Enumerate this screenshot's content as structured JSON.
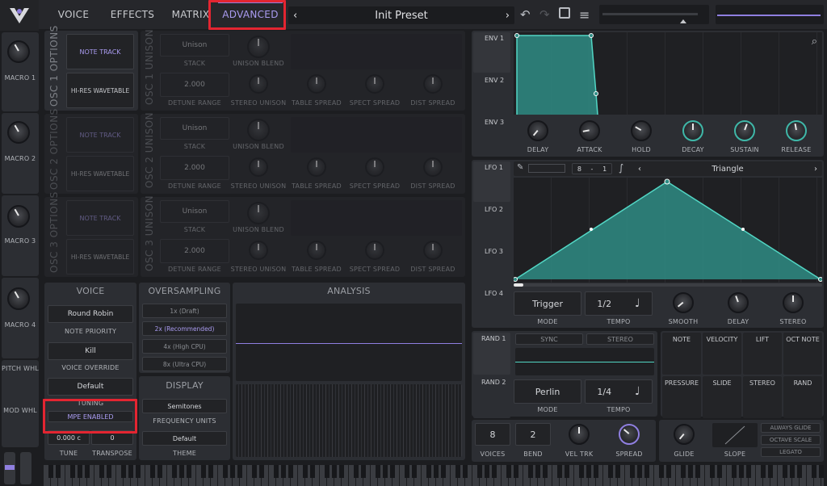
{
  "tabs": [
    {
      "label": "VOICE"
    },
    {
      "label": "EFFECTS"
    },
    {
      "label": "MATRIX"
    },
    {
      "label": "ADVANCED"
    }
  ],
  "preset": {
    "name": "Init Preset"
  },
  "macros": [
    {
      "label": "MACRO 1"
    },
    {
      "label": "MACRO 2"
    },
    {
      "label": "MACRO 3"
    },
    {
      "label": "MACRO 4"
    }
  ],
  "sidebar_bottom": {
    "pitch_label": "PITCH WHL",
    "mod_label": "MOD WHL"
  },
  "osc_options": [
    {
      "title": "OSC 1 OPTIONS",
      "unison_title": "OSC 1 UNISON",
      "note_track": "NOTE TRACK",
      "hires": "HI-RES WAVETABLE",
      "stack_value": "Unison",
      "stack_label": "STACK",
      "blend_label": "UNISON BLEND",
      "detune_value": "2.000",
      "detune_label": "DETUNE RANGE",
      "stereo_label": "STEREO UNISON",
      "table_label": "TABLE SPREAD",
      "spect_label": "SPECT SPREAD",
      "dist_label": "DIST SPREAD"
    },
    {
      "title": "OSC 2 OPTIONS",
      "unison_title": "OSC 2 UNISON",
      "note_track": "NOTE TRACK",
      "hires": "HI-RES WAVETABLE",
      "stack_value": "Unison",
      "stack_label": "STACK",
      "blend_label": "UNISON BLEND",
      "detune_value": "2.000",
      "detune_label": "DETUNE RANGE",
      "stereo_label": "STEREO UNISON",
      "table_label": "TABLE SPREAD",
      "spect_label": "SPECT SPREAD",
      "dist_label": "DIST SPREAD"
    },
    {
      "title": "OSC 3 OPTIONS",
      "unison_title": "OSC 3 UNISON",
      "note_track": "NOTE TRACK",
      "hires": "HI-RES WAVETABLE",
      "stack_value": "Unison",
      "stack_label": "STACK",
      "blend_label": "UNISON BLEND",
      "detune_value": "2.000",
      "detune_label": "DETUNE RANGE",
      "stereo_label": "STEREO UNISON",
      "table_label": "TABLE SPREAD",
      "spect_label": "SPECT SPREAD",
      "dist_label": "DIST SPREAD"
    }
  ],
  "voice": {
    "title": "VOICE",
    "priority_value": "Round Robin",
    "priority_label": "NOTE PRIORITY",
    "override_value": "Kill",
    "override_label": "VOICE OVERRIDE",
    "tuning_value": "Default",
    "tuning_label": "TUNING",
    "mpe_label": "MPE ENABLED",
    "tune_value": "0.000 c",
    "tune_label": "TUNE",
    "transpose_value": "0",
    "transpose_label": "TRANSPOSE"
  },
  "oversampling": {
    "title": "OVERSAMPLING",
    "options": [
      "1x (Draft)",
      "2x (Recommended)",
      "4x (High CPU)",
      "8x (Ultra CPU)"
    ],
    "selected_index": 1
  },
  "display": {
    "title": "DISPLAY",
    "freq_value": "Semitones",
    "freq_label": "FREQUENCY UNITS",
    "theme_value": "Default",
    "theme_label": "THEME"
  },
  "analysis": {
    "title": "ANALYSIS"
  },
  "envelopes": {
    "tabs": [
      "ENV 1",
      "ENV 2",
      "ENV 3"
    ],
    "knobs": [
      "DELAY",
      "ATTACK",
      "HOLD",
      "DECAY",
      "SUSTAIN",
      "RELEASE"
    ]
  },
  "lfos": {
    "tabs": [
      "LFO 1",
      "LFO 2",
      "LFO 3",
      "LFO 4"
    ],
    "sync_num": "8",
    "sync_den": "1",
    "shape": "Triangle",
    "mode_value": "Trigger",
    "mode_label": "MODE",
    "tempo_value": "1/2",
    "tempo_label": "TEMPO",
    "knobs": [
      "SMOOTH",
      "DELAY",
      "STEREO"
    ]
  },
  "randoms": {
    "tabs": [
      "RAND 1",
      "RAND 2"
    ],
    "sync_label": "SYNC",
    "stereo_label": "STEREO",
    "mode_value": "Perlin",
    "mode_label": "MODE",
    "tempo_value": "1/4",
    "tempo_label": "TEMPO"
  },
  "mod_sources": [
    "NOTE",
    "VELOCITY",
    "LIFT",
    "OCT NOTE",
    "PRESSURE",
    "SLIDE",
    "STEREO",
    "RAND"
  ],
  "bottom": {
    "voices_value": "8",
    "voices_label": "VOICES",
    "bend_value": "2",
    "bend_label": "BEND",
    "veltrk_label": "VEL TRK",
    "spread_label": "SPREAD",
    "glide_label": "GLIDE",
    "slope_label": "SLOPE",
    "always_glide": "ALWAYS GLIDE",
    "octave_scale": "OCTAVE SCALE",
    "legato": "LEGATO"
  },
  "colors": {
    "accent": "#8f7fe0",
    "teal": "#3fb7a8",
    "highlight_box": "#e32531"
  }
}
